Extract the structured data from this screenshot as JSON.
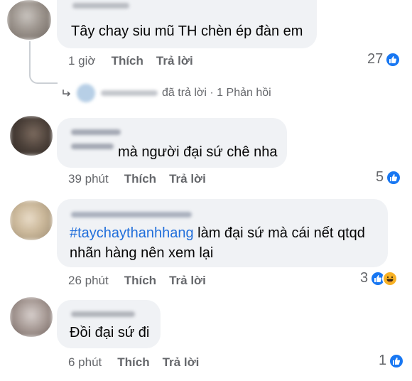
{
  "comments": [
    {
      "text": "Tây chay siu mũ TH chèn ép đàn em",
      "time": "1 giờ",
      "like_label": "Thích",
      "reply_label": "Trả lời",
      "reaction_count": "27"
    },
    {
      "text": "mà người đại sứ chê nha",
      "time": "39 phút",
      "like_label": "Thích",
      "reply_label": "Trả lời",
      "reaction_count": "5"
    },
    {
      "hashtag": "#taychaythanhhang",
      "text_line1_rest": " làm đại sứ mà cái nết qtqd",
      "text_line2": "nhãn hàng nên xem lại",
      "time": "26 phút",
      "like_label": "Thích",
      "reply_label": "Trả lời",
      "reaction_count": "3"
    },
    {
      "text": "Đồi đại sứ đi",
      "time": "6 phút",
      "like_label": "Thích",
      "reply_label": "Trả lời",
      "reaction_count": "1"
    }
  ],
  "reply_summary": {
    "text": "đã trả lời · 1 Phản hồi"
  },
  "icons": {
    "like": "like-thumb-icon",
    "haha": "haha-face-icon"
  },
  "colors": {
    "bubble": "#f0f2f5",
    "like_blue": "#1877f2",
    "hashtag": "#216fdb",
    "meta_gray": "#65676b"
  }
}
